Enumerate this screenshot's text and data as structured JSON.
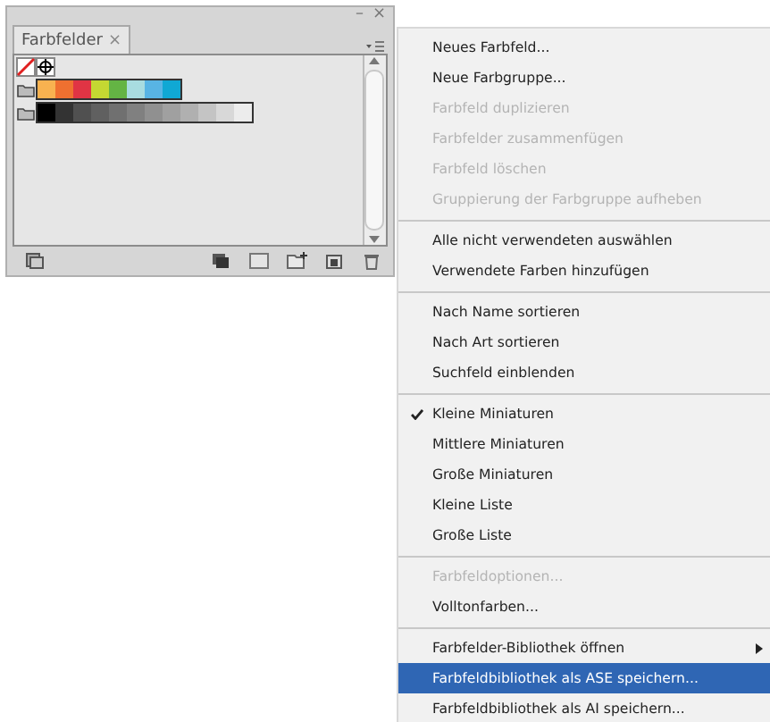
{
  "window": {
    "minimize": "–",
    "close": "×"
  },
  "panel": {
    "tab": {
      "label": "Farbfelder",
      "close": "×",
      "selected": true
    },
    "swatch_rows": [
      {
        "kind": "special",
        "swatches": [
          {
            "kind": "none"
          },
          {
            "kind": "registration"
          }
        ]
      },
      {
        "kind": "group",
        "swatches": [
          {
            "color": "#f8b250"
          },
          {
            "color": "#ef7030"
          },
          {
            "color": "#e03444"
          },
          {
            "color": "#c4d832"
          },
          {
            "color": "#64b444"
          },
          {
            "color": "#a8dce0"
          },
          {
            "color": "#58b4e4"
          },
          {
            "color": "#10a8d4"
          }
        ]
      },
      {
        "kind": "group",
        "swatches": [
          {
            "color": "#000000"
          },
          {
            "color": "#333333"
          },
          {
            "color": "#505050"
          },
          {
            "color": "#606060"
          },
          {
            "color": "#707070"
          },
          {
            "color": "#808080"
          },
          {
            "color": "#909090"
          },
          {
            "color": "#a0a0a0"
          },
          {
            "color": "#b0b0b0"
          },
          {
            "color": "#c4c4c4"
          },
          {
            "color": "#d8d8d8"
          },
          {
            "color": "#ececec"
          }
        ]
      }
    ]
  },
  "menu": {
    "items": [
      {
        "kind": "item",
        "label": "Neues Farbfeld...",
        "disabled": false,
        "checked": false,
        "selected": false,
        "submenu": false
      },
      {
        "kind": "item",
        "label": "Neue Farbgruppe...",
        "disabled": false,
        "checked": false,
        "selected": false,
        "submenu": false
      },
      {
        "kind": "item",
        "label": "Farbfeld duplizieren",
        "disabled": true,
        "checked": false,
        "selected": false,
        "submenu": false
      },
      {
        "kind": "item",
        "label": "Farbfelder zusammenfügen",
        "disabled": true,
        "checked": false,
        "selected": false,
        "submenu": false
      },
      {
        "kind": "item",
        "label": "Farbfeld löschen",
        "disabled": true,
        "checked": false,
        "selected": false,
        "submenu": false
      },
      {
        "kind": "item",
        "label": "Gruppierung der Farbgruppe aufheben",
        "disabled": true,
        "checked": false,
        "selected": false,
        "submenu": false
      },
      {
        "kind": "separator"
      },
      {
        "kind": "item",
        "label": "Alle nicht verwendeten auswählen",
        "disabled": false,
        "checked": false,
        "selected": false,
        "submenu": false
      },
      {
        "kind": "item",
        "label": "Verwendete Farben hinzufügen",
        "disabled": false,
        "checked": false,
        "selected": false,
        "submenu": false
      },
      {
        "kind": "separator"
      },
      {
        "kind": "item",
        "label": "Nach Name sortieren",
        "disabled": false,
        "checked": false,
        "selected": false,
        "submenu": false
      },
      {
        "kind": "item",
        "label": "Nach Art sortieren",
        "disabled": false,
        "checked": false,
        "selected": false,
        "submenu": false
      },
      {
        "kind": "item",
        "label": "Suchfeld einblenden",
        "disabled": false,
        "checked": false,
        "selected": false,
        "submenu": false
      },
      {
        "kind": "separator"
      },
      {
        "kind": "item",
        "label": "Kleine Miniaturen",
        "disabled": false,
        "checked": true,
        "selected": false,
        "submenu": false
      },
      {
        "kind": "item",
        "label": "Mittlere Miniaturen",
        "disabled": false,
        "checked": false,
        "selected": false,
        "submenu": false
      },
      {
        "kind": "item",
        "label": "Große Miniaturen",
        "disabled": false,
        "checked": false,
        "selected": false,
        "submenu": false
      },
      {
        "kind": "item",
        "label": "Kleine Liste",
        "disabled": false,
        "checked": false,
        "selected": false,
        "submenu": false
      },
      {
        "kind": "item",
        "label": "Große Liste",
        "disabled": false,
        "checked": false,
        "selected": false,
        "submenu": false
      },
      {
        "kind": "separator"
      },
      {
        "kind": "item",
        "label": "Farbfeldoptionen...",
        "disabled": true,
        "checked": false,
        "selected": false,
        "submenu": false
      },
      {
        "kind": "item",
        "label": "Volltonfarben...",
        "disabled": false,
        "checked": false,
        "selected": false,
        "submenu": false
      },
      {
        "kind": "separator"
      },
      {
        "kind": "item",
        "label": "Farbfelder-Bibliothek öffnen",
        "disabled": false,
        "checked": false,
        "selected": false,
        "submenu": true
      },
      {
        "kind": "item",
        "label": "Farbfeldbibliothek als ASE speichern...",
        "disabled": false,
        "checked": false,
        "selected": true,
        "submenu": false
      },
      {
        "kind": "item",
        "label": "Farbfeldbibliothek als AI speichern...",
        "disabled": false,
        "checked": false,
        "selected": false,
        "submenu": false
      }
    ]
  }
}
